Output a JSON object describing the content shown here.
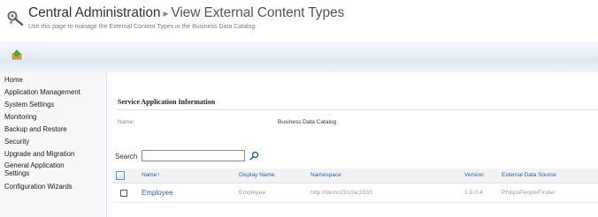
{
  "header": {
    "title": "Central Administration",
    "separator": "▸",
    "page": "View External Content Types",
    "description": "Use this page to manage the External Content Types in the Business Data Catalog."
  },
  "sidebar": {
    "items": [
      {
        "label": "Home"
      },
      {
        "label": "Application Management"
      },
      {
        "label": "System Settings"
      },
      {
        "label": "Monitoring"
      },
      {
        "label": "Backup and Restore"
      },
      {
        "label": "Security"
      },
      {
        "label": "Upgrade and Migration"
      },
      {
        "label": "General Application"
      },
      {
        "label": "Settings"
      },
      {
        "label": "Configuration Wizards"
      }
    ]
  },
  "service_info": {
    "section_title": "Service Application Information",
    "name_label": "Name:",
    "name_value": "Business Data Catalog"
  },
  "search": {
    "label": "Search",
    "value": ""
  },
  "table": {
    "headers": {
      "name": "Name",
      "sort_indicator": "↑",
      "display_name": "Display Name",
      "namespace": "Namespace",
      "version": "Version",
      "external_data_source": "External Data Source"
    },
    "rows": [
      {
        "name": "Employee",
        "display_name": "Employee",
        "namespace": "http://demo2010a:3333",
        "version": "1.0.0.4",
        "external_data_source": "PhilipsPeopleFinder"
      }
    ]
  },
  "colors": {
    "link": "#2f5c96",
    "band": "#dfe7f1",
    "sidebar_bg": "#f6f7f9"
  },
  "icons": {
    "header": "site-settings-icon",
    "navigate_up": "navigate-up-icon",
    "search": "search-icon",
    "select_all": "select-all-icon"
  }
}
